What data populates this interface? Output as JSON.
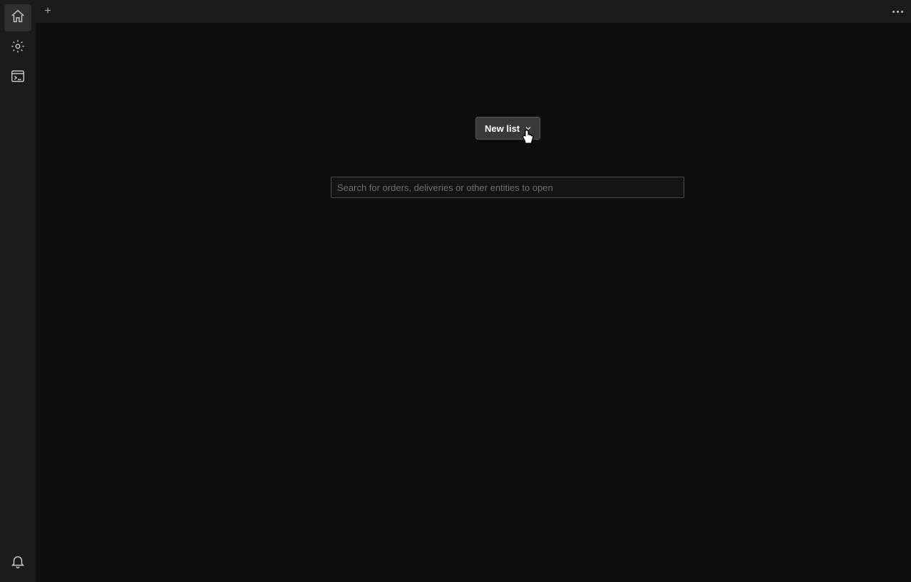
{
  "sidebar": {
    "items": [
      {
        "name": "home-icon",
        "active": true
      },
      {
        "name": "gear-icon",
        "active": false
      },
      {
        "name": "terminal-icon",
        "active": false
      }
    ],
    "bottom": {
      "name": "bell-icon"
    }
  },
  "tabbar": {
    "new_tab_glyph": "+",
    "overflow_name": "more-horizontal-icon"
  },
  "main": {
    "new_list_label": "New list",
    "search_placeholder": "Search for orders, deliveries or other entities to open"
  }
}
